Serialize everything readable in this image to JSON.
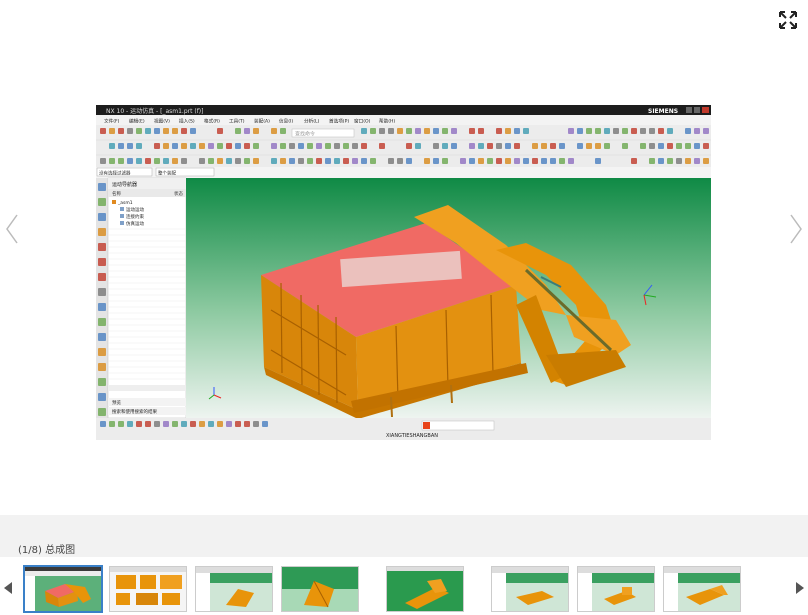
{
  "viewer": {
    "caption": "(1/8) 总成图",
    "fullscreen_icon": "expand-icon",
    "prev_icon": "chevron-left-icon",
    "next_icon": "chevron-right-icon"
  },
  "screenshot": {
    "window_title": "NX 10 - 运动仿真 - [_asm1.prt  (f)]",
    "brand": "SIEMENS",
    "menus": [
      "文件(F)",
      "编辑(E)",
      "视图(V)",
      "插入(S)",
      "格式(R)",
      "工具(T)",
      "装配(A)",
      "信息(I)",
      "分析(L)",
      "首选项(P)",
      "窗口(O)",
      "帮助(H)"
    ],
    "search_placeholder": "查找命令",
    "filter_dropdown": "没有选择过滤器",
    "assembly_dropdown": "整个装配",
    "navigator_title": "运动导航器",
    "nav_col_name": "名称",
    "nav_col_status": "状态",
    "tree": [
      "_asm1",
      "运动运动",
      "连接约束",
      "仿真运动"
    ],
    "panel_section_1": "预览",
    "panel_section_2": "搜索和使用搜索的结果",
    "status_text": "XIANGTIESHANGBAN"
  },
  "thumbnails": {
    "count": 8,
    "active_index": 0
  },
  "colors": {
    "accent": "#3a80c8",
    "model_orange": "#e8940a",
    "highlight_red": "#f06a64",
    "bg_green": "#1a9a50"
  }
}
